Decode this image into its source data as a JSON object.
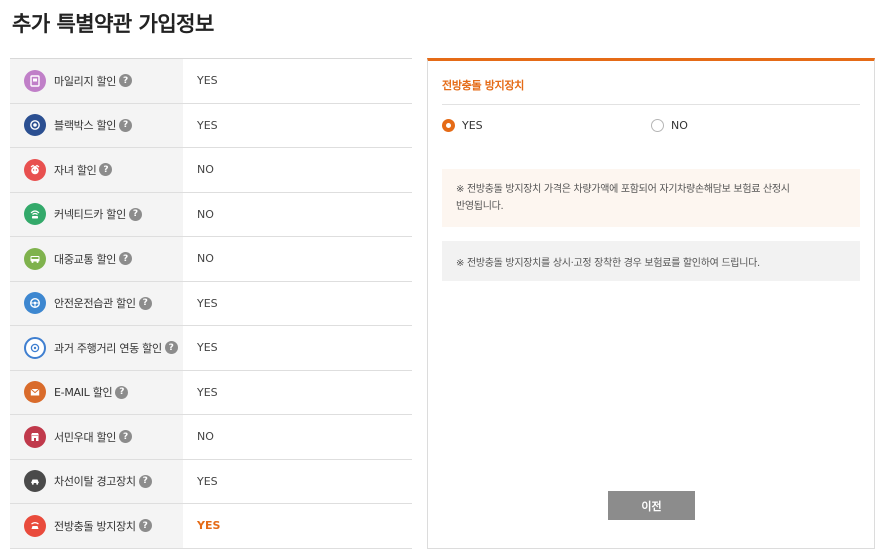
{
  "page": {
    "title": "추가 특별약관 가입정보"
  },
  "help_glyph": "?",
  "options": [
    {
      "label": "마일리지 할인",
      "value": "YES",
      "icon": "mileage-icon",
      "color": "#c07fc8"
    },
    {
      "label": "블랙박스 할인",
      "value": "YES",
      "icon": "blackbox-icon",
      "color": "#2b4f91"
    },
    {
      "label": "자녀 할인",
      "value": "NO",
      "icon": "child-icon",
      "color": "#e8504f"
    },
    {
      "label": "커넥티드카 할인",
      "value": "NO",
      "icon": "connected-car-icon",
      "color": "#33a96a"
    },
    {
      "label": "대중교통 할인",
      "value": "NO",
      "icon": "bus-icon",
      "color": "#7fb24d"
    },
    {
      "label": "안전운전습관 할인",
      "value": "YES",
      "icon": "safe-driving-icon",
      "color": "#3d87d0"
    },
    {
      "label": "과거 주행거리 연동 할인",
      "value": "YES",
      "icon": "odometer-icon",
      "color": "#3f7fd0"
    },
    {
      "label": "E-MAIL 할인",
      "value": "YES",
      "icon": "email-icon",
      "color": "#d96b2b"
    },
    {
      "label": "서민우대 할인",
      "value": "NO",
      "icon": "store-icon",
      "color": "#c0394b"
    },
    {
      "label": "차선이탈 경고장치",
      "value": "YES",
      "icon": "lane-departure-icon",
      "color": "#4a4a4a"
    },
    {
      "label": "전방충돌 방지장치",
      "value": "YES",
      "icon": "collision-warning-icon",
      "color": "#e94b3c",
      "active": true
    }
  ],
  "panel": {
    "title": "전방충돌 방지장치",
    "yes_label": "YES",
    "no_label": "NO",
    "selected": "YES",
    "notice1_line1": "※ 전방충돌 방지장치 가격은 차량가액에 포함되어 자기차량손해담보 보험료 산정시",
    "notice1_line2": "반영됩니다.",
    "notice2": "※ 전방충돌 방지장치를 상시·고정 장착한 경우 보험료를 할인하여 드립니다.",
    "prev_button": "이전"
  },
  "colors": {
    "accent": "#e56b17",
    "button": "#8c8c8c",
    "help": "#8c8c8c"
  }
}
